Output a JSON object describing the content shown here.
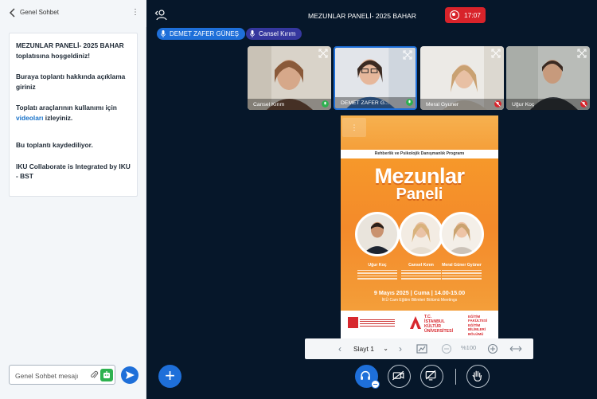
{
  "chat": {
    "title": "Genel Sohbet",
    "welcome": {
      "meeting_name": "MEZUNLAR PANELİ- 2025 BAHAR",
      "welcome_suffix": "toplatısına hoşgeldiniz!",
      "desc_line": "Buraya toplantı hakkında açıklama giriniz",
      "tools_text_before": "Toplatı araçlarının kullanımı için",
      "tools_link": "videoları",
      "tools_text_after": "izleyiniz.",
      "recording_note": "Bu toplantı kaydediliyor.",
      "integration_note": "IKU Collaborate is Integrated by IKU - BST"
    },
    "input_placeholder": "Genel Sohbet mesajı"
  },
  "header": {
    "meeting_title": "MEZUNLAR PANELİ- 2025 BAHAR",
    "recording_time": "17:07"
  },
  "talkers": [
    {
      "name": "DEMET ZAFER GÜNEŞ",
      "color": "#1e6fd9"
    },
    {
      "name": "Cansel Kırım",
      "color": "#35379e"
    }
  ],
  "videos": [
    {
      "name": "Cansel Kırım",
      "active": false,
      "mic": "on"
    },
    {
      "name": "DEMET ZAFER G...",
      "active": true,
      "mic": "on"
    },
    {
      "name": "Meral Gyuner",
      "active": false,
      "mic": "muted"
    },
    {
      "name": "Uğur Koç",
      "active": false,
      "mic": "muted"
    }
  ],
  "slide": {
    "program": "Rehberlik ve Psikolojik Danışmanlık Programı",
    "title_line1": "Mezunlar",
    "title_line2": "Paneli",
    "speakers": [
      "Uğur Koç",
      "Cansel Kırım",
      "Meral Güner Gyüner"
    ],
    "date": "9 Mayıs 2025 | Cuma | 14.00-15.00",
    "place": "İKÜ Cam Eğitim Bilimleri Bölümü Meetings",
    "university": [
      "T.C.",
      "İSTANBUL",
      "KÜLTÜR",
      "ÜNİVERSİTESİ"
    ],
    "department": [
      "EĞİTİM",
      "FAKÜLTESİ",
      "EĞİTİM BİLİMLERİ",
      "BÖLÜMÜ"
    ]
  },
  "slide_toolbar": {
    "current_slide": "Slayt 1",
    "zoom": "%100"
  },
  "colors": {
    "primary": "#1e6fd9",
    "record": "#d8232a",
    "background": "#06172a",
    "slide_orange": "#f48a2a"
  }
}
